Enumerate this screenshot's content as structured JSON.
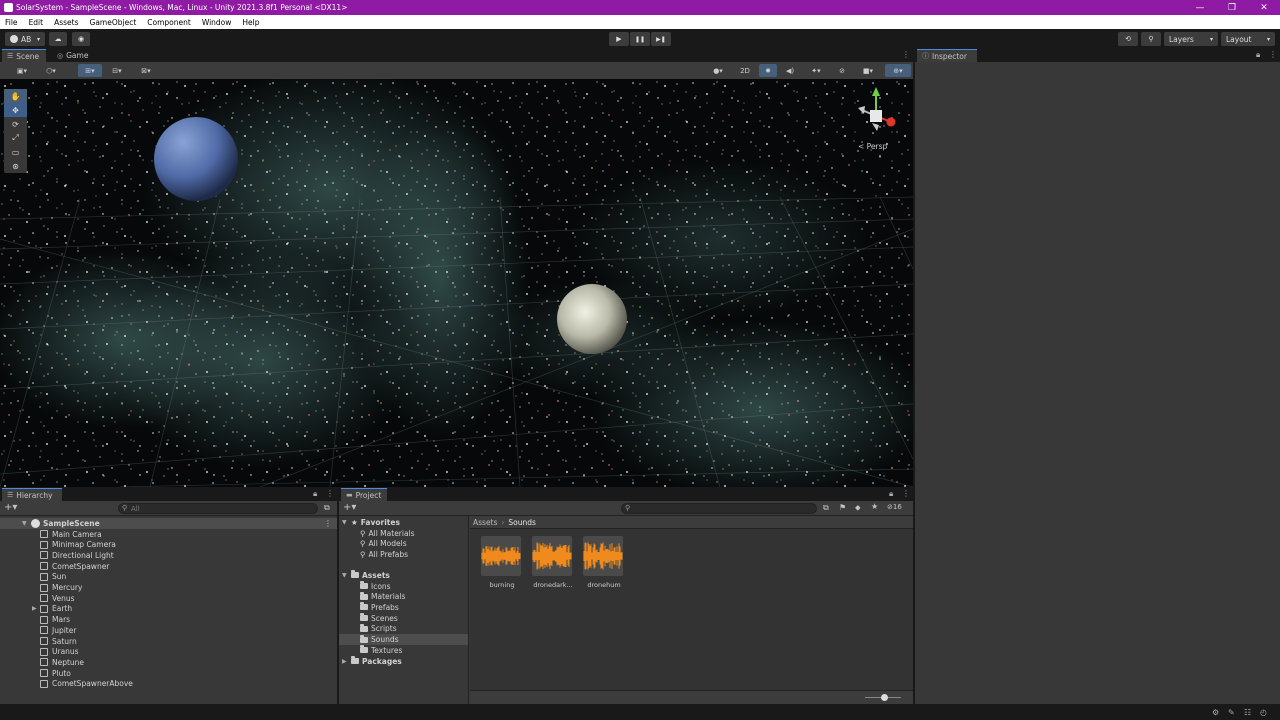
{
  "window": {
    "title": "SolarSystem - SampleScene - Windows, Mac, Linux - Unity 2021.3.8f1 Personal <DX11>",
    "controls": [
      "—",
      "❐",
      "✕"
    ]
  },
  "menu": [
    "File",
    "Edit",
    "Assets",
    "GameObject",
    "Component",
    "Window",
    "Help"
  ],
  "toolbar": {
    "account": "AB",
    "play": "▶",
    "pause": "❚❚",
    "step": "▶❚",
    "layers": "Layers",
    "layout": "Layout"
  },
  "scene_panel": {
    "tabs": [
      "Scene",
      "Game"
    ],
    "mode_2d": "2D",
    "persp_label": "< Persp"
  },
  "inspector": {
    "tab": "Inspector"
  },
  "hierarchy": {
    "tab": "Hierarchy",
    "search_placeholder": "All",
    "scene_name": "SampleScene",
    "items": [
      "Main Camera",
      "Minimap Camera",
      "Directional Light",
      "CometSpawner",
      "Sun",
      "Mercury",
      "Venus",
      "Earth",
      "Mars",
      "Jupiter",
      "Saturn",
      "Uranus",
      "Neptune",
      "Pluto",
      "CometSpawnerAbove"
    ]
  },
  "project": {
    "tab": "Project",
    "hidden_count": "16",
    "favorites": {
      "label": "Favorites",
      "items": [
        "All Materials",
        "All Models",
        "All Prefabs"
      ]
    },
    "assets": {
      "label": "Assets",
      "items": [
        "Icons",
        "Materials",
        "Prefabs",
        "Scenes",
        "Scripts",
        "Sounds",
        "Textures"
      ],
      "selected": "Sounds"
    },
    "packages": "Packages",
    "breadcrumb": [
      "Assets",
      "Sounds"
    ],
    "files": [
      "burning",
      "dronedark...",
      "dronehum"
    ],
    "zoom": 0.55
  },
  "colors": {
    "title_bar": "#8f1aa3",
    "accent": "#4a8be8",
    "audio_wave": "#f08a1c"
  }
}
